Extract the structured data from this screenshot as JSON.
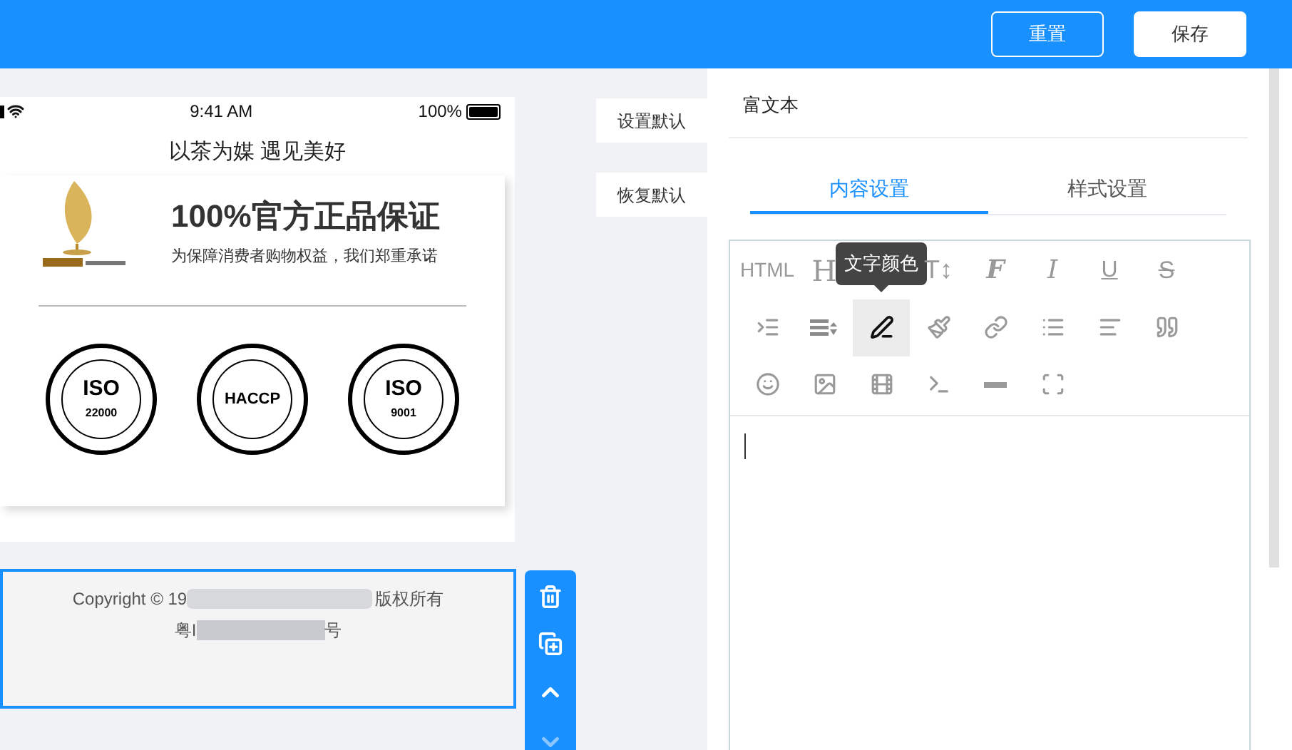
{
  "header": {
    "buttons": [
      {
        "label": "重置",
        "kind": "outline"
      },
      {
        "label": "保存",
        "kind": "solid"
      }
    ]
  },
  "phone": {
    "status_bar": {
      "time": "9:41 AM",
      "battery": "100%"
    },
    "title": "以茶为媒 遇见美好",
    "banner": {
      "headline": "100%官方正品保证",
      "subline": "为保障消费者购物权益，我们郑重承诺",
      "seals": [
        {
          "name": "ISO",
          "number": "22000"
        },
        {
          "name": "HACCP"
        },
        {
          "name": "ISO",
          "number": "9001"
        }
      ]
    }
  },
  "side_buttons": [
    "设置默认",
    "恢复默认"
  ],
  "footer": {
    "selected": true,
    "line1_start": "Copyright © 19",
    "line1_end": "版权所有",
    "line2_start": "粤I",
    "line2_end": "号"
  },
  "panel": {
    "title": "富文本",
    "tabs": [
      {
        "label": "内容设置",
        "selected": true
      },
      {
        "label": "样式设置",
        "selected": false
      }
    ],
    "format_buttons": [
      "HTML",
      "H",
      "T↕",
      "F",
      "I",
      "U",
      "S"
    ],
    "tool_rows": [
      [
        {
          "active": false
        },
        {
          "active": false
        },
        {
          "active": true
        },
        {
          "active": false
        },
        {
          "active": false
        },
        {
          "active": false
        },
        {
          "active": false
        },
        {
          "active": false
        }
      ],
      [
        {
          "active": false
        },
        {
          "active": false
        },
        {
          "active": false
        },
        {
          "active": false
        },
        {
          "active": false
        },
        {
          "active": false
        }
      ]
    ],
    "tooltip": "文字颜色"
  }
}
